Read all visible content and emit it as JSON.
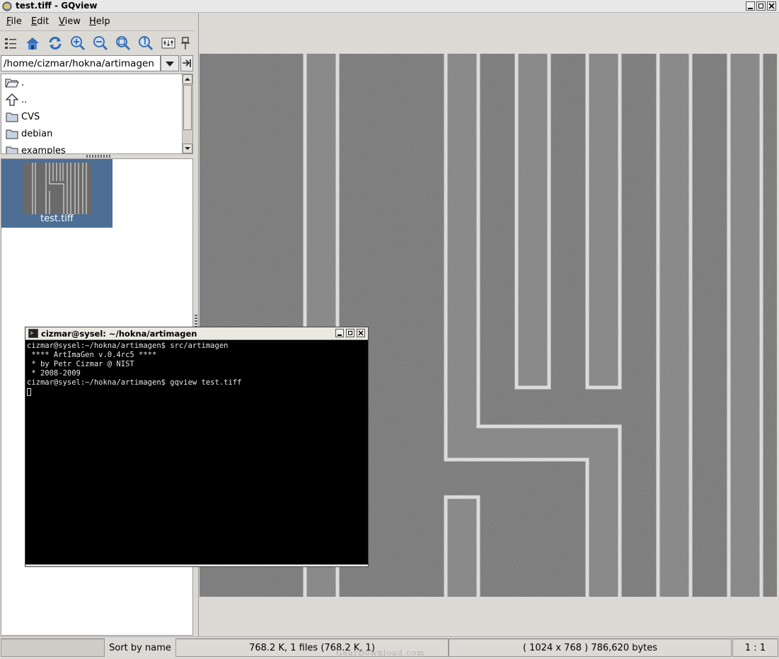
{
  "window": {
    "title": "test.tiff - GQview"
  },
  "menu": [
    {
      "label": "File",
      "mnemonic": "F",
      "rest": "ile"
    },
    {
      "label": "Edit",
      "mnemonic": "E",
      "rest": "dit"
    },
    {
      "label": "View",
      "mnemonic": "V",
      "rest": "iew"
    },
    {
      "label": "Help",
      "mnemonic": "H",
      "rest": "elp"
    }
  ],
  "toolbar": {
    "icons": [
      "thumbnails-toggle-icon",
      "home-icon",
      "refresh-icon",
      "zoom-in-icon",
      "zoom-out-icon",
      "zoom-fit-icon",
      "zoom-1to1-icon",
      "configure-icon",
      "float-icon"
    ]
  },
  "path": {
    "value": "/home/cizmar/hokna/artimagen"
  },
  "folders": [
    {
      "label": ".",
      "icon": "open-folder-icon"
    },
    {
      "label": "..",
      "icon": "up-arrow-icon"
    },
    {
      "label": "CVS",
      "icon": "folder-icon"
    },
    {
      "label": "debian",
      "icon": "folder-icon"
    },
    {
      "label": "examples",
      "icon": "folder-icon"
    }
  ],
  "thumbnails": [
    {
      "label": "test.tiff"
    }
  ],
  "terminal": {
    "title": "cizmar@sysel: ~/hokna/artimagen",
    "lines": [
      "cizmar@sysel:~/hokna/artimagen$ src/artimagen",
      "",
      " **** ArtImaGen v.0.4rc5 ****",
      " * by Petr Cizmar @ NIST",
      " * 2008-2009",
      "",
      "cizmar@sysel:~/hokna/artimagen$ gqview test.tiff"
    ]
  },
  "status": {
    "sort": "Sort by name",
    "files": "768.2 K, 1 files (768.2 K, 1)",
    "image_info": "( 1024 x 768 ) 786,620 bytes",
    "zoom": "1 : 1"
  },
  "watermark": "GearDownload.com",
  "colors": {
    "selection": "#4d6f96",
    "terminal_bg": "#000000",
    "window_bg": "#dcdad5"
  }
}
